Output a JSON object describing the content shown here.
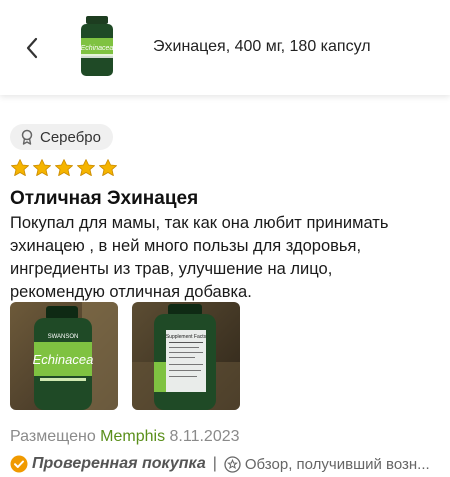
{
  "header": {
    "product_title": "Эхинацея, 400 мг, 180 капсул",
    "product_thumb_label": "Echinacea"
  },
  "badge": {
    "icon": "medal-icon",
    "label": "Серебро"
  },
  "review": {
    "rating": 5,
    "rating_max": 5,
    "title": "Отличная Эхинацея",
    "body_lines": [
      "Покупал для мамы, так как она любит принимать",
      "эхинацею , в ней много пользы для здоровья,",
      "ингредиенты из трав, улучшение на лицо,",
      "рекомендую отличная добавка."
    ],
    "photos": [
      {
        "label": "Echinacea",
        "brand": "SWANSON"
      },
      {
        "label": "Supplement Facts"
      }
    ],
    "posted_prefix": "Размещено",
    "author": "Memphis",
    "date": "8.11.2023",
    "verified_label": "Проверенная покупка",
    "separator": "|",
    "review_type": "Обзор, получивший возн..."
  },
  "colors": {
    "star": "#f5b400",
    "author": "#5a8f1a",
    "verified": "#f09a00",
    "bottle": "#1f4a26"
  }
}
